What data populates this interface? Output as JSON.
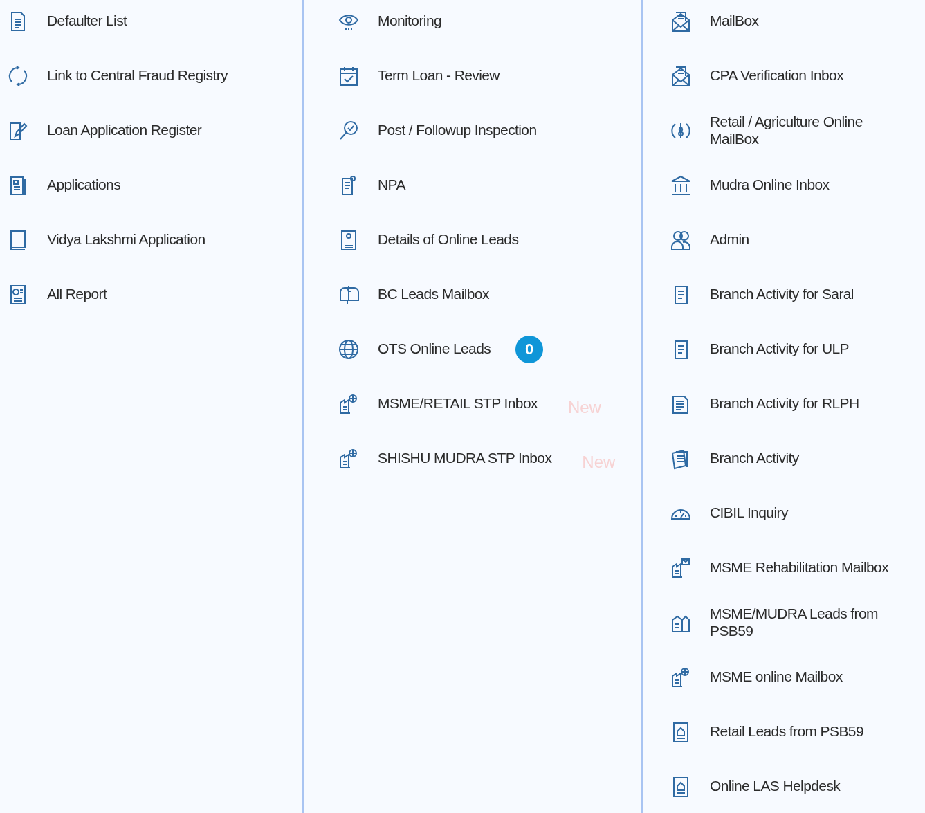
{
  "columns": [
    {
      "items": [
        {
          "label": "Defaulter List",
          "kind": "plain"
        },
        {
          "label": "Link to Central Fraud Registry",
          "kind": "plain"
        },
        {
          "label": "Loan Application Register",
          "kind": "plain"
        },
        {
          "label": "Applications",
          "kind": "plain"
        },
        {
          "label": "Vidya Lakshmi Application",
          "kind": "plain"
        },
        {
          "label": "All Report",
          "kind": "plain"
        }
      ]
    },
    {
      "items": [
        {
          "label": "Monitoring",
          "kind": "plain"
        },
        {
          "label": "Term Loan - Review",
          "kind": "plain"
        },
        {
          "label": "Post / Followup Inspection",
          "kind": "plain"
        },
        {
          "label": "NPA",
          "kind": "plain"
        },
        {
          "label": "Details of Online Leads",
          "kind": "plain"
        },
        {
          "label": "BC Leads Mailbox",
          "kind": "plain"
        },
        {
          "label": "OTS Online Leads",
          "kind": "count",
          "count": "0"
        },
        {
          "label": "MSME/RETAIL STP Inbox",
          "kind": "new",
          "tag": "New"
        },
        {
          "label": "SHISHU MUDRA STP Inbox",
          "kind": "new",
          "tag": "New"
        }
      ]
    },
    {
      "items": [
        {
          "label": "MailBox",
          "kind": "plain"
        },
        {
          "label": "CPA Verification Inbox",
          "kind": "plain"
        },
        {
          "label": "Retail / Agriculture Online MailBox",
          "kind": "plain"
        },
        {
          "label": "Mudra Online Inbox",
          "kind": "plain"
        },
        {
          "label": "Admin",
          "kind": "plain"
        },
        {
          "label": "Branch Activity for Saral",
          "kind": "plain"
        },
        {
          "label": "Branch Activity for ULP",
          "kind": "plain"
        },
        {
          "label": "Branch Activity for RLPH",
          "kind": "plain"
        },
        {
          "label": "Branch Activity",
          "kind": "plain"
        },
        {
          "label": "CIBIL Inquiry",
          "kind": "plain"
        },
        {
          "label": "MSME Rehabilitation Mailbox",
          "kind": "plain"
        },
        {
          "label": "MSME/MUDRA Leads from PSB59",
          "kind": "plain"
        },
        {
          "label": "MSME online Mailbox",
          "kind": "plain"
        },
        {
          "label": "Retail Leads from PSB59",
          "kind": "plain"
        },
        {
          "label": "Online LAS Helpdesk",
          "kind": "plain"
        }
      ]
    }
  ]
}
